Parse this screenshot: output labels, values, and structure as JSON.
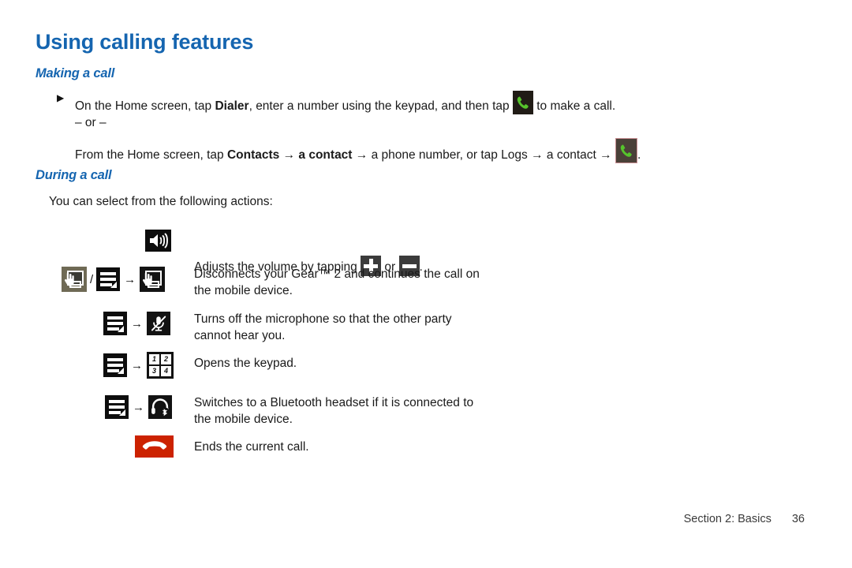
{
  "page": {
    "title": "Using calling features",
    "footer": {
      "section": "Section 2:  Basics",
      "page_number": "36"
    },
    "accent_color": "#1565b0",
    "text_color": "#1a1a1a"
  },
  "making_a_call": {
    "heading": "Making a call",
    "bullet_marker": "▶",
    "line1": {
      "part1": "On the Home screen, tap ",
      "bold1": "Dialer",
      "part2": ", enter a number using the keypad, and then tap ",
      "icon": "green-phone-icon",
      "part3": " to make a call."
    },
    "or_separator": "– or –",
    "line2": {
      "part1": "From the Home screen, tap ",
      "bold1": "Contacts",
      "arrow1": " → ",
      "bold2": "a contact",
      "part2": " → a phone number, or tap Logs → a contact → ",
      "icon": "green-phone-icon",
      "part3": "."
    }
  },
  "during_a_call": {
    "heading": "During a call",
    "intro": "You can select from the following actions:",
    "actions": [
      {
        "id": "volume",
        "icons": [
          "speaker-icon"
        ],
        "text_part1": "Adjusts the volume by tapping ",
        "inline_icon1": "plus-icon",
        "text_part2": " or ",
        "inline_icon2": "minus-icon",
        "text_part3": "."
      },
      {
        "id": "disconnect-gear",
        "icons": [
          "hand-device-icon",
          "slash",
          "menu-icon",
          "arrow",
          "hand-device-dark-icon"
        ],
        "text": "Disconnects your Gear™ 2 and continues the call on\nthe mobile device."
      },
      {
        "id": "mute",
        "icons": [
          "menu-icon",
          "arrow",
          "mute-mic-icon"
        ],
        "text": "Turns off the microphone so that the other party\ncannot hear you."
      },
      {
        "id": "keypad",
        "icons": [
          "menu-icon",
          "arrow",
          "keypad-icon"
        ],
        "text": "Opens the keypad.",
        "keypad_digits": [
          "1",
          "2",
          "3",
          "4"
        ]
      },
      {
        "id": "bluetooth-headset",
        "icons": [
          "menu-icon",
          "arrow",
          "bluetooth-headset-icon"
        ],
        "text": "Switches to a Bluetooth headset if it is connected to\nthe mobile device."
      },
      {
        "id": "end-call",
        "icons": [
          "end-call-icon"
        ],
        "text": "Ends the current call."
      }
    ],
    "arrow_glyph": "→",
    "slash_glyph": "/"
  },
  "colors": {
    "phone_green": "#56c32c",
    "phone_bg": "#211c16",
    "phone_bg_alt": "#4a4038",
    "end_call_red": "#cc2200",
    "icon_black": "#0d0d0d",
    "icon_gray": "#3b3b3b",
    "hand_icon_bg": "#6f6a55"
  }
}
